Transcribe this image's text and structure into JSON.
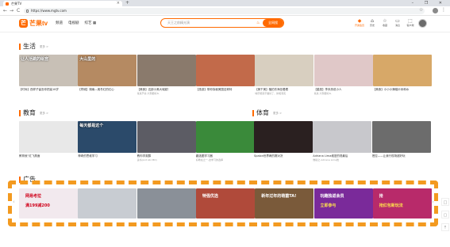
{
  "browser": {
    "tab_title": "芒果TV",
    "tab_close": "×",
    "new_tab": "+",
    "window_controls": "– ❐ ✕",
    "url": "https://www.mgtv.com",
    "back": "←",
    "forward": "→",
    "reload": "C",
    "bookmark": "☆",
    "menu": "⋮"
  },
  "header": {
    "logo_mark": "芒",
    "logo_text": "芒果tv",
    "nav": [
      "频道",
      "电视剧",
      "综艺 ▦"
    ],
    "search_placeholder": "天王之前精光演",
    "search_button": "全网搜",
    "utilities": [
      {
        "glyph": "◆",
        "label": "开通会员"
      },
      {
        "glyph": "⌂",
        "label": "历史"
      },
      {
        "glyph": "☆",
        "label": "收藏"
      },
      {
        "glyph": "▭",
        "label": "消息"
      },
      {
        "glyph": "⬚",
        "label": "客户端"
      }
    ]
  },
  "sections": {
    "life": {
      "title": "生活",
      "more": "更多 >"
    },
    "education": {
      "title": "教育",
      "more": "更多 >"
    },
    "sports": {
      "title": "体育",
      "more": "更多 >"
    },
    "ads": {
      "title": "广告"
    }
  },
  "life_items": [
    {
      "overlay": "让人活跳的绘宫",
      "caption": "【时尚】西祥子留言你把高18岁",
      "sub": "",
      "color": "#c8c0b6"
    },
    {
      "overlay": "大山里的",
      "caption": "【同城】湖南—奥冬红的红心",
      "sub": "",
      "color": "#b58a62"
    },
    {
      "overlay": "",
      "caption": "【美食】这部小美大城越！",
      "sub": "某某节奏·大家都好么",
      "color": "#8a7a6c"
    },
    {
      "overlay": "",
      "caption": "【旅游】带你探秘美国这奇特",
      "sub": "",
      "color": "#c26a4a"
    },
    {
      "overlay": "",
      "caption": "【美千美】植拍东海岛看看",
      "sub": "城乐能就不做好了，拼和真实",
      "color": "#d8cfc0"
    },
    {
      "overlay": "",
      "caption": "【星座】李未然说小人",
      "sub": "某某·大家都好么",
      "color": "#e0c8c8"
    },
    {
      "overlay": "",
      "caption": "【美食】小小小辣椒炒米和水",
      "sub": "",
      "color": "#d7a868"
    }
  ],
  "education_items": [
    {
      "overlay": "",
      "caption": "教育就“红飞燕面",
      "sub": "",
      "color": "#e8e8e8"
    },
    {
      "overlay": "每天都是这个",
      "caption": "神奇的思维学习",
      "sub": "",
      "color": "#2b4a6a"
    },
    {
      "overlay": "",
      "caption": "教你学英醇",
      "sub": "读书(Ant Abi MO)",
      "color": "#5c5c64"
    },
    {
      "overlay": "",
      "caption": "趣选图学习器",
      "sub": "好教在之一-这学习的选择",
      "color": "#3a8a3a"
    }
  ],
  "sports_items": [
    {
      "overlay": "",
      "caption": "Spalon世界两的赛对决",
      "sub": "",
      "color": "#2a2020"
    },
    {
      "overlay": "",
      "caption": "Adriana Lima维密的现最后",
      "sub": "维秘之·Adriana Lima舞",
      "color": "#c8c8cc"
    },
    {
      "overlay": "",
      "caption": "把控——让我行现场超好玩",
      "sub": "",
      "color": "#6c6c6c"
    }
  ],
  "ad_items": [
    {
      "line1": "网易考拉",
      "line2": "满199减200",
      "color": "#f2e9ee"
    },
    {
      "line1": "",
      "line2": "",
      "color": "#c8ccd2"
    },
    {
      "line1": "",
      "line2": "",
      "color": "#8a9098"
    },
    {
      "line1": "特强优选",
      "line2": "",
      "color": "#b04a3a"
    },
    {
      "line1": "新年过年的萌菌TA!",
      "line2": "",
      "color": "#7a5a3a"
    },
    {
      "line1": "玩趣独返会员",
      "line2": "立即参与",
      "color": "#7a2a9a"
    },
    {
      "line1": "抢",
      "line2": "抢红包新玩法",
      "color": "#b82a6a"
    }
  ],
  "side_tools": [
    "□",
    "▢",
    "⤒"
  ]
}
